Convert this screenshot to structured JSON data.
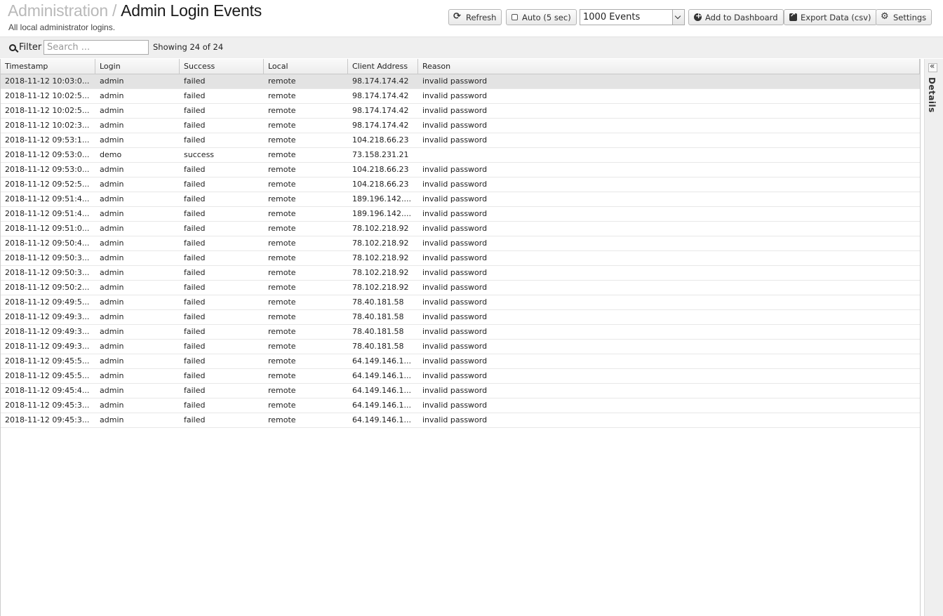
{
  "header": {
    "breadcrumb_parent": "Administration",
    "breadcrumb_separator": "/",
    "title": "Admin Login Events",
    "subtitle": "All local administrator logins."
  },
  "buttons": {
    "refresh": "Refresh",
    "auto": "Auto (5 sec)",
    "events_select": "1000 Events",
    "add_dashboard": "Add to Dashboard",
    "export": "Export Data (csv)",
    "settings": "Settings"
  },
  "toolbar": {
    "filter_label": "Filter",
    "search_placeholder": "Search ...",
    "showing": "Showing 24 of 24"
  },
  "table": {
    "columns": [
      "Timestamp",
      "Login",
      "Success",
      "Local",
      "Client Address",
      "Reason"
    ],
    "rows": [
      [
        "2018-11-12 10:03:0...",
        "admin",
        "failed",
        "remote",
        "98.174.174.42",
        "invalid password"
      ],
      [
        "2018-11-12 10:02:5...",
        "admin",
        "failed",
        "remote",
        "98.174.174.42",
        "invalid password"
      ],
      [
        "2018-11-12 10:02:5...",
        "admin",
        "failed",
        "remote",
        "98.174.174.42",
        "invalid password"
      ],
      [
        "2018-11-12 10:02:3...",
        "admin",
        "failed",
        "remote",
        "98.174.174.42",
        "invalid password"
      ],
      [
        "2018-11-12 09:53:1...",
        "admin",
        "failed",
        "remote",
        "104.218.66.23",
        "invalid password"
      ],
      [
        "2018-11-12 09:53:0...",
        "demo",
        "success",
        "remote",
        "73.158.231.21",
        ""
      ],
      [
        "2018-11-12 09:53:0...",
        "admin",
        "failed",
        "remote",
        "104.218.66.23",
        "invalid password"
      ],
      [
        "2018-11-12 09:52:5...",
        "admin",
        "failed",
        "remote",
        "104.218.66.23",
        "invalid password"
      ],
      [
        "2018-11-12 09:51:4...",
        "admin",
        "failed",
        "remote",
        "189.196.142....",
        "invalid password"
      ],
      [
        "2018-11-12 09:51:4...",
        "admin",
        "failed",
        "remote",
        "189.196.142....",
        "invalid password"
      ],
      [
        "2018-11-12 09:51:0...",
        "admin",
        "failed",
        "remote",
        "78.102.218.92",
        "invalid password"
      ],
      [
        "2018-11-12 09:50:4...",
        "admin",
        "failed",
        "remote",
        "78.102.218.92",
        "invalid password"
      ],
      [
        "2018-11-12 09:50:3...",
        "admin",
        "failed",
        "remote",
        "78.102.218.92",
        "invalid password"
      ],
      [
        "2018-11-12 09:50:3...",
        "admin",
        "failed",
        "remote",
        "78.102.218.92",
        "invalid password"
      ],
      [
        "2018-11-12 09:50:2...",
        "admin",
        "failed",
        "remote",
        "78.102.218.92",
        "invalid password"
      ],
      [
        "2018-11-12 09:49:5...",
        "admin",
        "failed",
        "remote",
        "78.40.181.58",
        "invalid password"
      ],
      [
        "2018-11-12 09:49:3...",
        "admin",
        "failed",
        "remote",
        "78.40.181.58",
        "invalid password"
      ],
      [
        "2018-11-12 09:49:3...",
        "admin",
        "failed",
        "remote",
        "78.40.181.58",
        "invalid password"
      ],
      [
        "2018-11-12 09:49:3...",
        "admin",
        "failed",
        "remote",
        "78.40.181.58",
        "invalid password"
      ],
      [
        "2018-11-12 09:45:5...",
        "admin",
        "failed",
        "remote",
        "64.149.146.1...",
        "invalid password"
      ],
      [
        "2018-11-12 09:45:5...",
        "admin",
        "failed",
        "remote",
        "64.149.146.1...",
        "invalid password"
      ],
      [
        "2018-11-12 09:45:4...",
        "admin",
        "failed",
        "remote",
        "64.149.146.1...",
        "invalid password"
      ],
      [
        "2018-11-12 09:45:3...",
        "admin",
        "failed",
        "remote",
        "64.149.146.1...",
        "invalid password"
      ],
      [
        "2018-11-12 09:45:3...",
        "admin",
        "failed",
        "remote",
        "64.149.146.1...",
        "invalid password"
      ]
    ]
  },
  "side_panel": {
    "label": "Details"
  }
}
